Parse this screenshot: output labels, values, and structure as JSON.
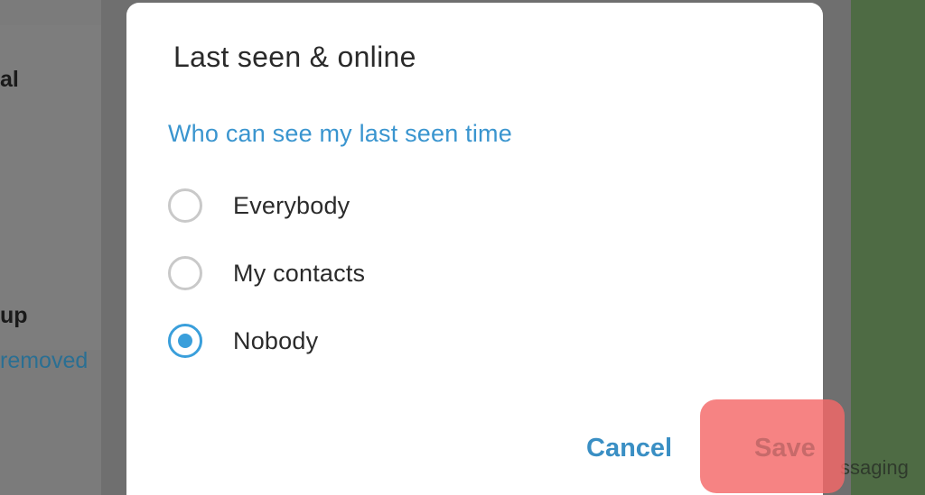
{
  "background": {
    "left_texts": [
      "al",
      "up"
    ],
    "left_link": "removed",
    "right_text": "ssaging"
  },
  "dialog": {
    "title": "Last seen & online",
    "section_label": "Who can see my last seen time",
    "options": [
      {
        "label": "Everybody",
        "selected": false
      },
      {
        "label": "My contacts",
        "selected": false
      },
      {
        "label": "Nobody",
        "selected": true
      }
    ],
    "cancel_label": "Cancel",
    "save_label": "Save"
  },
  "colors": {
    "accent": "#3a9fdb",
    "highlight": "#f46868",
    "overlay": "#7a7a7a"
  }
}
